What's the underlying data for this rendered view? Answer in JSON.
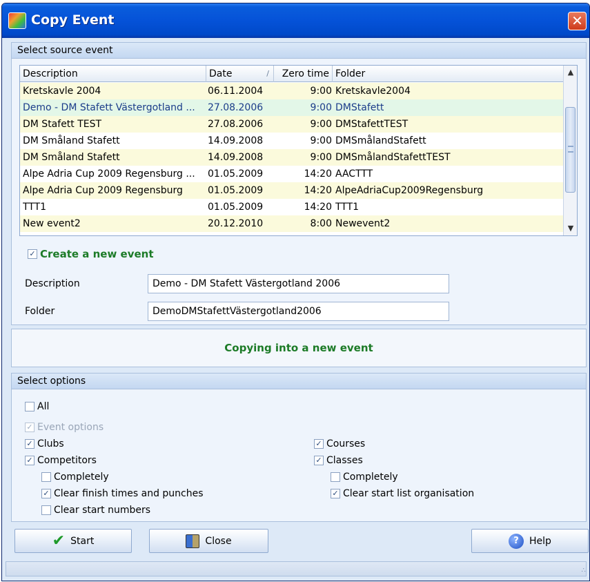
{
  "window": {
    "title": "Copy Event",
    "close_glyph": "✕"
  },
  "source_group": {
    "header": "Select source event"
  },
  "table": {
    "columns": [
      "Description",
      "Date",
      "Zero time",
      "Folder"
    ],
    "sort_indicator": "/",
    "rows": [
      {
        "description": "Kretskavle 2004",
        "date": "06.11.2004",
        "zero_time": "9:00",
        "folder": "Kretskavle2004",
        "style": "alt"
      },
      {
        "description": "Demo - DM Stafett Västergotland ...",
        "date": "27.08.2006",
        "zero_time": "9:00",
        "folder": "DMStafett",
        "style": "sel"
      },
      {
        "description": "DM Stafett TEST",
        "date": "27.08.2006",
        "zero_time": "9:00",
        "folder": "DMStafettTEST",
        "style": "alt"
      },
      {
        "description": "DM Småland Stafett",
        "date": "14.09.2008",
        "zero_time": "9:00",
        "folder": "DMSmålandStafett",
        "style": ""
      },
      {
        "description": "DM Småland Stafett",
        "date": "14.09.2008",
        "zero_time": "9:00",
        "folder": "DMSmålandStafettTEST",
        "style": "alt"
      },
      {
        "description": "Alpe Adria Cup 2009 Regensburg ...",
        "date": "01.05.2009",
        "zero_time": "14:20",
        "folder": "AACTTT",
        "style": ""
      },
      {
        "description": "Alpe Adria Cup 2009 Regensburg",
        "date": "01.05.2009",
        "zero_time": "14:20",
        "folder": "AlpeAdriaCup2009Regensburg",
        "style": "alt"
      },
      {
        "description": "TTT1",
        "date": "01.05.2009",
        "zero_time": "14:20",
        "folder": "TTT1",
        "style": ""
      },
      {
        "description": "New event2",
        "date": "20.12.2010",
        "zero_time": "8:00",
        "folder": "Newevent2",
        "style": "alt"
      }
    ]
  },
  "create_new": {
    "label": "Create a new event",
    "checked": true
  },
  "fields": {
    "description_label": "Description",
    "description_value": "Demo - DM Stafett Västergotland 2006",
    "folder_label": "Folder",
    "folder_value": "DemoDMStafettVästergotland2006"
  },
  "status_message": "Copying into a new event",
  "options_group": {
    "header": "Select options",
    "all": "All",
    "event_options": "Event options",
    "clubs": "Clubs",
    "competitors": "Competitors",
    "completely_left": "Completely",
    "clear_finish": "Clear finish times and punches",
    "clear_start_numbers": "Clear start numbers",
    "courses": "Courses",
    "classes": "Classes",
    "completely_right": "Completely",
    "clear_start_list": "Clear start list organisation"
  },
  "buttons": {
    "start": "Start",
    "close": "Close",
    "help": "Help"
  },
  "icons": {
    "check": "✔",
    "help": "?",
    "checkmark": "✓",
    "scroll_up": "▲",
    "scroll_down": "▼",
    "grip": "∴"
  },
  "colors": {
    "title_bar": "#0552d8",
    "accent_green": "#1c7b27",
    "row_alt": "#fbfadc",
    "row_selected": "#e3f7e8"
  }
}
